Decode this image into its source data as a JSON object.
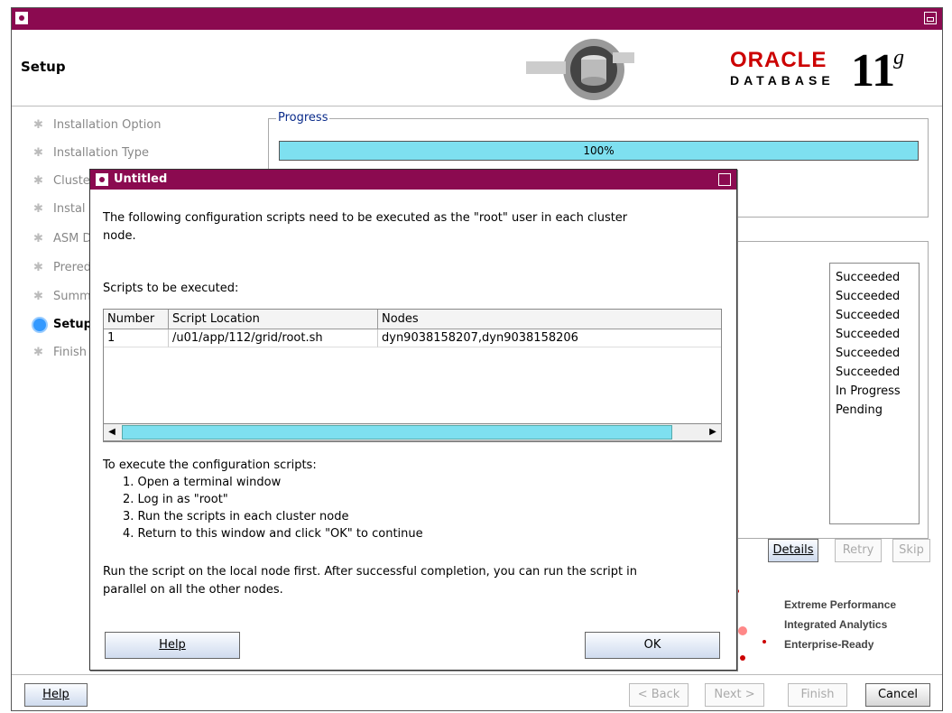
{
  "window": {
    "title": ""
  },
  "header": {
    "title": "Setup",
    "brand": "ORACLE",
    "product": "DATABASE",
    "version": "11",
    "version_sup": "g"
  },
  "sidebar": {
    "items": [
      {
        "label": "Installation Option",
        "active": false
      },
      {
        "label": "Installation Type",
        "active": false
      },
      {
        "label": "Cluste",
        "active": false
      },
      {
        "label": "Instal",
        "active": false
      },
      {
        "label": "ASM D",
        "active": false
      },
      {
        "label": "Prered",
        "active": false
      },
      {
        "label": "Summ",
        "active": false
      },
      {
        "label": "Setup",
        "active": true
      },
      {
        "label": "Finish",
        "active": false
      }
    ]
  },
  "progress": {
    "group_label": "Progress",
    "value_text": "100%",
    "fraction": 1.0
  },
  "status": {
    "items": [
      "Succeeded",
      "Succeeded",
      "Succeeded",
      "Succeeded",
      "Succeeded",
      "Succeeded",
      "In Progress",
      "Pending"
    ]
  },
  "actions": {
    "details": "Details",
    "retry": "Retry",
    "skip": "Skip"
  },
  "taglines": [
    "Extreme Performance",
    "Integrated Analytics",
    "Enterprise-Ready"
  ],
  "footer": {
    "help": "Help",
    "back": "< Back",
    "next": "Next >",
    "finish": "Finish",
    "cancel": "Cancel"
  },
  "dialog": {
    "title": "Untitled",
    "intro_line1": "The following configuration scripts need to be executed as the \"root\" user in each cluster",
    "intro_line2": "node.",
    "scripts_label": "Scripts to be executed:",
    "table": {
      "headers": [
        "Number",
        "Script Location",
        "Nodes"
      ],
      "rows": [
        [
          "1",
          "/u01/app/112/grid/root.sh",
          "dyn9038158207,dyn9038158206"
        ]
      ]
    },
    "instructions_title": "To execute the configuration scripts:",
    "steps": [
      "1. Open a terminal window",
      "2. Log in as \"root\"",
      "3. Run the scripts in each cluster node",
      "4. Return to this window and click \"OK\" to continue"
    ],
    "note_line1": "Run the script on the local node first. After successful completion, you can run the script in",
    "note_line2": "parallel on all the other nodes.",
    "help": "Help",
    "ok": "OK"
  }
}
